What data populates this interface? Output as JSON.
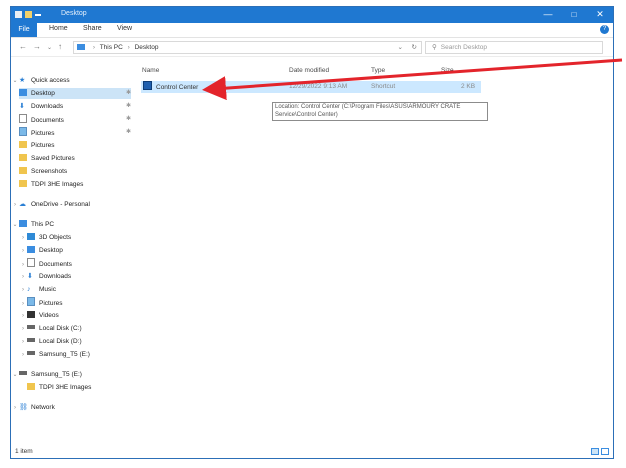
{
  "window": {
    "title": "Desktop"
  },
  "ribbon": {
    "file": "File",
    "home": "Home",
    "share": "Share",
    "view": "View",
    "help": "?"
  },
  "titlebar": {
    "minimize": "—",
    "maximize": "□",
    "close": "✕"
  },
  "address": {
    "back": "←",
    "forward": "→",
    "up": "↑",
    "path": [
      "This PC",
      "Desktop"
    ],
    "separator": "›",
    "dropdown": "⌄",
    "refresh": "↻",
    "search_placeholder": "Search Desktop"
  },
  "nav": {
    "quick_access": "Quick access",
    "quick_items": [
      "Desktop",
      "Downloads",
      "Documents",
      "Pictures",
      "Pictures",
      "Saved Pictures",
      "Screenshots",
      "TDPI 3HE Images"
    ],
    "onedrive": "OneDrive - Personal",
    "this_pc": "This PC",
    "pc_items": [
      "3D Objects",
      "Desktop",
      "Documents",
      "Downloads",
      "Music",
      "Pictures",
      "Videos",
      "Local Disk (C:)",
      "Local Disk (D:)",
      "Samsung_T5 (E:)"
    ],
    "usb": "Samsung_T5 (E:)",
    "usb_items": [
      "TDPI 3HE Images"
    ],
    "network": "Network",
    "pin": "✱"
  },
  "columns": {
    "name": "Name",
    "date": "Date modified",
    "type": "Type",
    "size": "Size"
  },
  "files": [
    {
      "name": "Control Center",
      "date": "12/29/2022 9:13 AM",
      "type": "Shortcut",
      "size": "2 KB"
    }
  ],
  "tooltip": "Location: Control Center (C:\\Program Files\\ASUS\\ARMOURY CRATE Service\\Control Center)",
  "status": {
    "count": "1 item"
  },
  "colors": {
    "accent": "#1f78d1",
    "selection": "#cce8ff",
    "arrow": "#e3242b"
  }
}
